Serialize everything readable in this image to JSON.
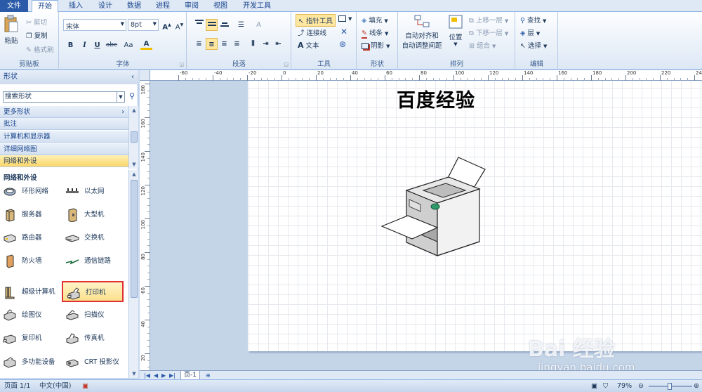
{
  "tabs": [
    "文件",
    "开始",
    "插入",
    "设计",
    "数据",
    "进程",
    "审阅",
    "视图",
    "开发工具"
  ],
  "ribbon": {
    "clipboard": {
      "paste": "粘贴",
      "cut": "剪切",
      "copy": "复制",
      "format_painter": "格式刷",
      "label": "剪贴板"
    },
    "font": {
      "name": "宋体",
      "size": "8pt",
      "bold": "B",
      "italic": "I",
      "underline": "U",
      "strike": "abc",
      "case": "Aa",
      "color": "A",
      "label": "字体"
    },
    "paragraph": {
      "label": "段落"
    },
    "tools": {
      "pointer": "指针工具",
      "connector": "连接线",
      "text": "文本",
      "label": "工具"
    },
    "shape": {
      "fill": "填充",
      "line": "线条",
      "shadow": "阴影",
      "label": "形状"
    },
    "arrange": {
      "auto_align": "自动对齐和",
      "auto_space": "自动调整间距",
      "position": "位置",
      "bring_forward": "上移一层",
      "send_backward": "下移一层",
      "group": "组合",
      "label": "排列"
    },
    "edit": {
      "find": "查找",
      "layer": "层",
      "select": "选择",
      "label": "编辑"
    }
  },
  "panel": {
    "title": "形状",
    "search_value": "搜索形状",
    "categories": [
      "更多形状",
      "批注",
      "计算机和显示器",
      "详细网络图",
      "网络和外设"
    ],
    "stencil_title": "网络和外设",
    "shapes": [
      "环形网络",
      "以太网",
      "服务器",
      "大型机",
      "路由器",
      "交换机",
      "防火墙",
      "通信链路",
      "超级计算机",
      "打印机",
      "绘图仪",
      "扫描仪",
      "复印机",
      "传真机",
      "多功能设备",
      "CRT 投影仪"
    ]
  },
  "ruler": {
    "h": [
      "-60",
      "-40",
      "-20",
      "0",
      "20",
      "40",
      "60",
      "80",
      "100",
      "120",
      "140",
      "160",
      "180",
      "200",
      "220",
      "240",
      "260"
    ],
    "v": [
      "180",
      "160",
      "140",
      "120",
      "100",
      "80",
      "60",
      "40",
      "20",
      "0"
    ]
  },
  "canvas": {
    "heading": "百度经验"
  },
  "page_tab": "页-1",
  "status": {
    "page": "页面 1/1",
    "language": "中文(中国)",
    "zoom": "79%"
  },
  "watermark": {
    "logo": "Bai 经验",
    "url": "jingyan.baidu.com"
  },
  "colors": {
    "accent": "#2a5aa8",
    "highlight": "#fbd76a",
    "selection_border": "#e03030"
  }
}
